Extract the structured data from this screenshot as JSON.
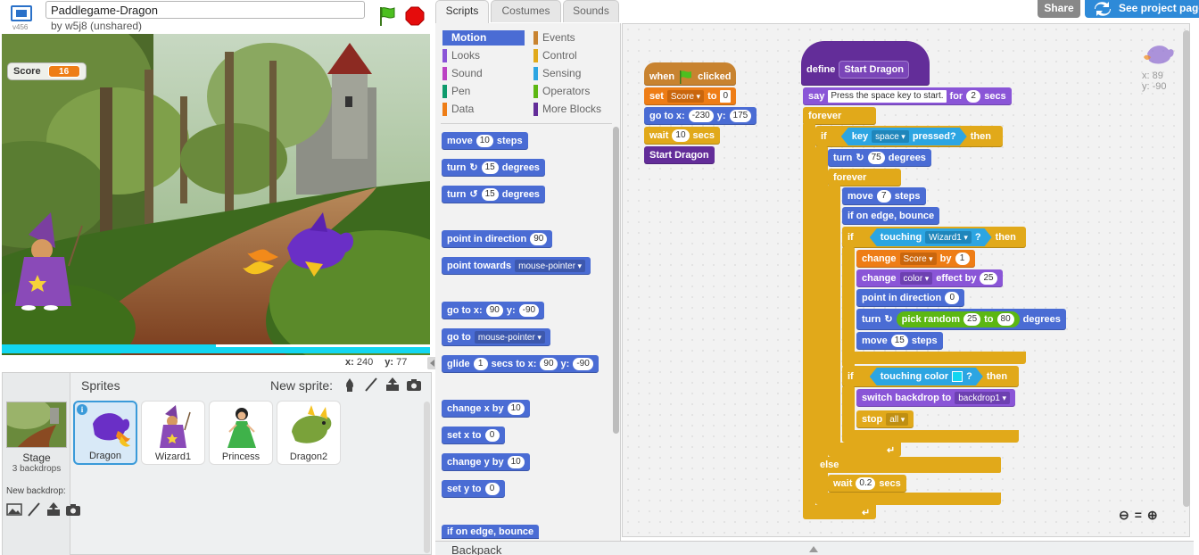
{
  "header": {
    "version": "v456",
    "project_title": "Paddlegame-Dragon",
    "byline": "by w5j8 (unshared)"
  },
  "stage": {
    "monitor_label": "Score",
    "monitor_value": "16",
    "x_label": "x:",
    "x_value": "240",
    "y_label": "y:",
    "y_value": "77"
  },
  "sprite_library": {
    "title": "Sprites",
    "new_sprite_label": "New sprite:",
    "stage_label": "Stage",
    "stage_backdrops": "3 backdrops",
    "new_backdrop_label": "New backdrop:",
    "sprites": [
      {
        "name": "Dragon"
      },
      {
        "name": "Wizard1"
      },
      {
        "name": "Princess"
      },
      {
        "name": "Dragon2"
      }
    ]
  },
  "tabs": {
    "scripts": "Scripts",
    "costumes": "Costumes",
    "sounds": "Sounds"
  },
  "top_right": {
    "share": "Share",
    "see_project": "See project page"
  },
  "categories": {
    "motion": "Motion",
    "looks": "Looks",
    "sound": "Sound",
    "pen": "Pen",
    "data": "Data",
    "events": "Events",
    "control": "Control",
    "sensing": "Sensing",
    "operators": "Operators",
    "more": "More Blocks"
  },
  "palette": {
    "move": "move",
    "move_n": "10",
    "steps": "steps",
    "turn": "turn",
    "turn_r_n": "15",
    "turn_l_n": "15",
    "degrees": "degrees",
    "point_dir": "point in direction",
    "point_dir_v": "90",
    "point_towards": "point towards",
    "point_towards_v": "mouse-pointer",
    "goto_xy": "go to x:",
    "goto_x": "90",
    "y_lbl": "y:",
    "goto_y": "-90",
    "goto": "go to",
    "goto_v": "mouse-pointer",
    "glide": "glide",
    "glide_n": "1",
    "glide_mid": "secs to x:",
    "glide_x": "90",
    "glide_y": "-90",
    "change_x": "change x by",
    "change_x_n": "10",
    "set_x": "set x to",
    "set_x_n": "0",
    "change_y": "change y by",
    "change_y_n": "10",
    "set_y": "set y to",
    "set_y_n": "0",
    "edge": "if on edge, bounce"
  },
  "script1": {
    "when": "when",
    "clicked": "clicked",
    "set": "set",
    "set_var": "Score",
    "to": "to",
    "set_val": "0",
    "goto": "go to x:",
    "x": "-230",
    "y_lbl": "y:",
    "y": "175",
    "wait": "wait",
    "wait_n": "10",
    "secs": "secs",
    "call": "Start Dragon"
  },
  "script2": {
    "define": "define",
    "name": "Start Dragon",
    "say": "say",
    "say_text": "Press the space key to start.",
    "say_for": "for",
    "say_n": "2",
    "say_secs": "secs",
    "forever": "forever",
    "if": "if",
    "key": "key",
    "key_v": "space",
    "pressed": "pressed?",
    "then": "then",
    "turn": "turn",
    "turn_n": "75",
    "degrees": "degrees",
    "forever2": "forever",
    "move": "move",
    "move_n": "7",
    "steps": "steps",
    "edge": "if on edge, bounce",
    "if2": "if",
    "touching": "touching",
    "touching_v": "Wizard1",
    "q": "?",
    "then2": "then",
    "change": "change",
    "change_var": "Score",
    "by": "by",
    "change_n": "1",
    "change_fx": "change",
    "fx_v": "color",
    "effect_by": "effect by",
    "fx_n": "25",
    "point_dir": "point in direction",
    "point_dir_v": "0",
    "turn2": "turn",
    "pick": "pick random",
    "pick_a": "25",
    "pick_to": "to",
    "pick_b": "80",
    "degrees2": "degrees",
    "move2": "move",
    "move2_n": "15",
    "steps2": "steps",
    "if3": "if",
    "touching_color": "touching color",
    "q2": "?",
    "then3": "then",
    "switch": "switch backdrop to",
    "switch_v": "backdrop1",
    "stop": "stop",
    "stop_v": "all",
    "else": "else",
    "wait": "wait",
    "wait_n": "0.2",
    "secs": "secs"
  },
  "sprite_info": {
    "x": "x: 89",
    "y": "y: -90"
  },
  "backpack": {
    "label": "Backpack"
  },
  "colors": {
    "motion": "#4a6cd4",
    "looks": "#8a55d7",
    "sound": "#bb42c3",
    "pen": "#0e9a6c",
    "data": "#ee7d16",
    "events": "#c88330",
    "control": "#e1a91a",
    "sensing": "#2ca5e2",
    "operators": "#5cb712",
    "more": "#632d99",
    "accent": "#2e8ad8",
    "touch_color": "#12d6f0"
  }
}
